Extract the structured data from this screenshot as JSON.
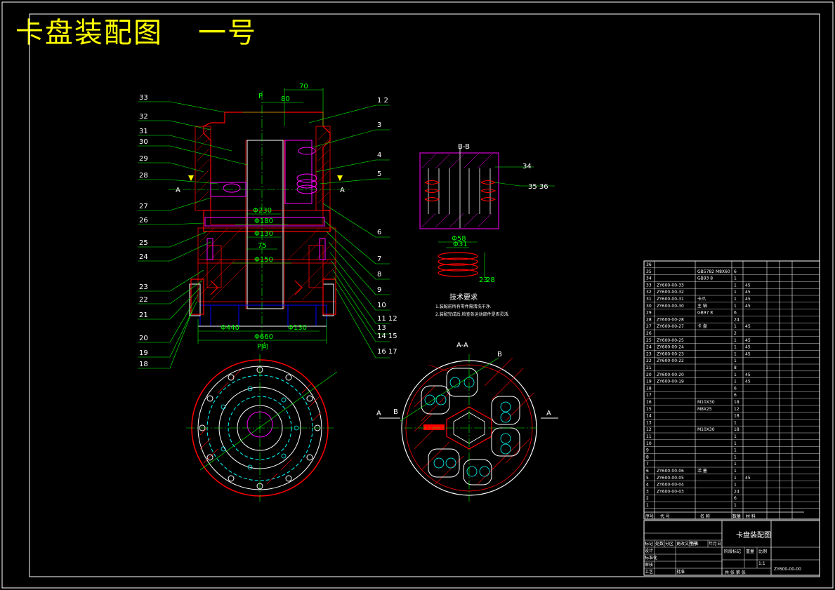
{
  "drawing": {
    "title": "卡盘装配图",
    "subtitle": "一号",
    "section_labels": {
      "p_top": "P",
      "p_bottom": "P向",
      "a_left": "A",
      "a_right": "A",
      "bb": "B-B",
      "aa": "A-A",
      "b_top": "B",
      "b_left": "B",
      "a2_left": "A",
      "a2_right": "A"
    },
    "dimensions": {
      "d70": "70",
      "d80": "80",
      "d230": "Φ230",
      "d180": "Φ180",
      "d130": "Φ130",
      "d75": "75",
      "d150": "Φ150",
      "d440": "Φ440",
      "d130b": "Φ130",
      "d660": "Φ660",
      "d58": "Φ58",
      "d31": "Φ31",
      "dh1": "23",
      "dh2": "28"
    },
    "callouts_left": [
      "33",
      "32",
      "31",
      "30",
      "29",
      "28",
      "27",
      "26",
      "25",
      "24",
      "23",
      "22",
      "21",
      "20",
      "19",
      "18"
    ],
    "callouts_right": [
      "1 2",
      "3",
      "4",
      "5",
      "6",
      "7",
      "8",
      "9",
      "10",
      "11 12",
      "13",
      "14 15",
      "16 17"
    ],
    "callouts_bb": [
      "34",
      "35 36"
    ],
    "tech_requirements": {
      "heading": "技术要求",
      "lines": [
        "1.装配前所有零件需清洗干净.",
        "2.装配完成后,检查各运动部件是否灵活."
      ]
    },
    "parts_table": {
      "rows": [
        [
          "36",
          "",
          "",
          "",
          ""
        ],
        [
          "35",
          "",
          "GB5782 M8X60",
          "6",
          ""
        ],
        [
          "34",
          "",
          "GB93 8",
          "1",
          ""
        ],
        [
          "33",
          "ZY600-00-33",
          "",
          "1",
          "45"
        ],
        [
          "32",
          "ZY600-00-32",
          "",
          "1",
          "45"
        ],
        [
          "31",
          "ZY600-00-31",
          "卡爪",
          "1",
          "45"
        ],
        [
          "30",
          "ZY600-00-30",
          "主 轴",
          "1",
          "45"
        ],
        [
          "29",
          "",
          "GB97 8",
          "6",
          ""
        ],
        [
          "28",
          "ZY600-00-28",
          "",
          "24",
          ""
        ],
        [
          "27",
          "ZY600-00-27",
          "卡 盘",
          "1",
          "45"
        ],
        [
          "26",
          "",
          "",
          "2",
          ""
        ],
        [
          "25",
          "ZY600-00-25",
          "",
          "1",
          "45"
        ],
        [
          "24",
          "ZY600-00-24",
          "",
          "1",
          "45"
        ],
        [
          "23",
          "ZY600-00-23",
          "",
          "1",
          "45"
        ],
        [
          "22",
          "ZY600-00-22",
          "",
          "1",
          ""
        ],
        [
          "21",
          "",
          "",
          "8",
          ""
        ],
        [
          "20",
          "ZY600-00-20",
          "",
          "1",
          "45"
        ],
        [
          "19",
          "ZY600-00-19",
          "",
          "1",
          "45"
        ],
        [
          "18",
          "",
          "",
          "6",
          ""
        ],
        [
          "17",
          "",
          "",
          "6",
          ""
        ],
        [
          "16",
          "",
          "M10X30",
          "18",
          ""
        ],
        [
          "15",
          "",
          "M8X25",
          "12",
          ""
        ],
        [
          "14",
          "",
          "",
          "18",
          ""
        ],
        [
          "13",
          "",
          "",
          "1",
          ""
        ],
        [
          "12",
          "",
          "M10X30",
          "18",
          ""
        ],
        [
          "11",
          "",
          "",
          "1",
          ""
        ],
        [
          "10",
          "",
          "",
          "1",
          ""
        ],
        [
          "9",
          "",
          "",
          "1",
          ""
        ],
        [
          "8",
          "",
          "",
          "1",
          ""
        ],
        [
          "7",
          "",
          "",
          "1",
          ""
        ],
        [
          "6",
          "ZY600-00-06",
          "活 塞",
          "1",
          ""
        ],
        [
          "5",
          "ZY600-00-05",
          "",
          "1",
          "45"
        ],
        [
          "4",
          "ZY600-00-04",
          "",
          "1",
          ""
        ],
        [
          "3",
          "ZY600-00-03",
          "",
          "24",
          ""
        ],
        [
          "2",
          "",
          "",
          "6",
          ""
        ],
        [
          "1",
          "",
          "",
          "1",
          ""
        ]
      ],
      "header": [
        "序号",
        "代 号",
        "名 称",
        "数量",
        "材 料"
      ],
      "title_block_name": "卡盘装配图",
      "drawing_number": "ZY600-00-00",
      "scale": "1:1",
      "sheet": "共 张 第 张",
      "title_block_labels": [
        "标记",
        "处数",
        "分区",
        "更改文件号",
        "签名",
        "年月日",
        "设计",
        "标准化",
        "审核",
        "工艺",
        "批准",
        "阶段标记",
        "重量",
        "比例"
      ]
    }
  },
  "colors": {
    "title": "#ffff00",
    "outline": "#ffffff",
    "section": "#ff0000",
    "dimension": "#00ff00",
    "hidden": "#00ffff",
    "hatch": "#ff00ff",
    "background": "#000000"
  }
}
